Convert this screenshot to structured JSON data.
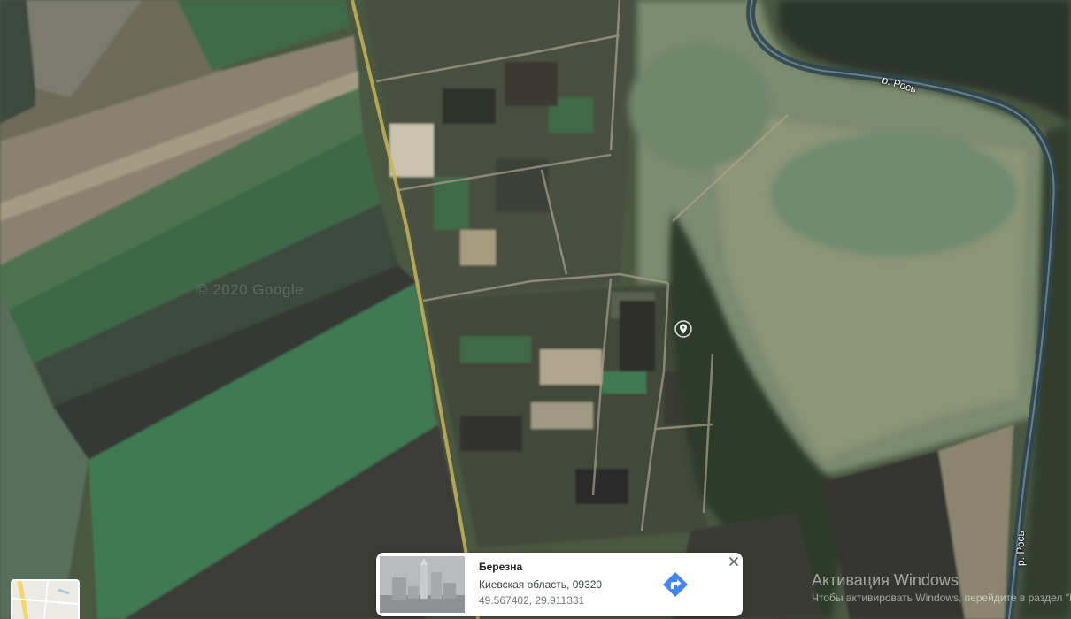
{
  "map": {
    "watermark": "© 2020 Google",
    "labels": [
      {
        "text": "р. Рось"
      },
      {
        "text": "р. Рось"
      }
    ],
    "pin_icon": "place-marker-icon",
    "colors": {
      "field_green": "#3f6a46",
      "field_dark": "#3b3a34",
      "meadow": "#76866b",
      "forest": "#2d3a2a",
      "river": "#2f4650"
    }
  },
  "place_card": {
    "name": "Березна",
    "address": "Киевская область, 09320",
    "coordinates": "49.567402, 29.911331",
    "directions_icon": "directions-arrow-icon",
    "close_icon": "close-icon",
    "accent": "#4285f4"
  },
  "activation_notice": {
    "title": "Активация Windows",
    "body": "Чтобы активировать Windows, перейдите в раздел \"Параметры\"."
  },
  "minimap": {
    "icon": "map-layers-thumbnail"
  }
}
